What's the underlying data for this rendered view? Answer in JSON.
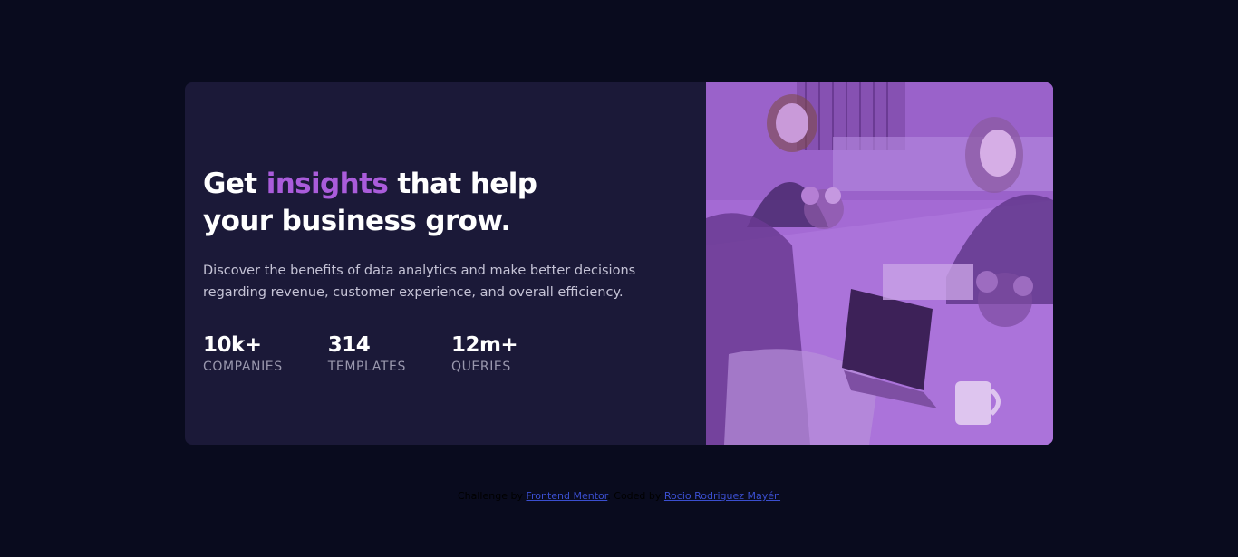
{
  "card": {
    "headline_before": "Get ",
    "headline_accent": "insights",
    "headline_after": " that help your business grow.",
    "description": "Discover the benefits of data analytics and make better decisions regarding revenue, customer experience, and overall efficiency.",
    "stats": [
      {
        "value": "10k+",
        "label": "COMPANIES"
      },
      {
        "value": "314",
        "label": "TEMPLATES"
      },
      {
        "value": "12m+",
        "label": "QUERIES"
      }
    ],
    "image_icon": "office-team-photo"
  },
  "footer": {
    "prefix": "Challenge by ",
    "challenge_link": "Frontend Mentor",
    "middle": ". Coded by ",
    "author_link": "Rocio Rodriguez Mayén"
  },
  "colors": {
    "page_background": "#090b1e",
    "card_background": "#1b1938",
    "accent": "#aa5cdb",
    "image_tint": "#a46ad4",
    "link": "#3b4fd0"
  }
}
